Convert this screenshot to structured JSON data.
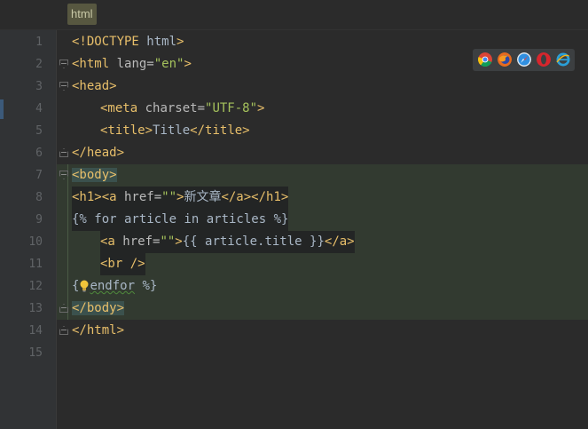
{
  "breadcrumb": {
    "label": "html"
  },
  "lines": [
    {
      "num": "1"
    },
    {
      "num": "2"
    },
    {
      "num": "3"
    },
    {
      "num": "4"
    },
    {
      "num": "5"
    },
    {
      "num": "6"
    },
    {
      "num": "7"
    },
    {
      "num": "8"
    },
    {
      "num": "9"
    },
    {
      "num": "10"
    },
    {
      "num": "11"
    },
    {
      "num": "12"
    },
    {
      "num": "13"
    },
    {
      "num": "14"
    },
    {
      "num": "15"
    }
  ],
  "code": {
    "l1": {
      "open": "<!DOCTYPE ",
      "name": "html",
      "close": ">"
    },
    "l2": {
      "tag": "<html",
      "attr": " lang=",
      "val": "\"en\"",
      "close": ">"
    },
    "l3": {
      "tag": "<head>"
    },
    "l4": {
      "tag": "<meta",
      "attr": " charset=",
      "val": "\"UTF-8\"",
      "close": ">"
    },
    "l5": {
      "open": "<title>",
      "text": "Title",
      "close": "</title>"
    },
    "l6": {
      "tag": "</head>"
    },
    "l7": {
      "tag": "<body>"
    },
    "l8": {
      "h1": "<h1>",
      "a": "<a",
      "attr": " href=",
      "val": "\"\"",
      "gt": ">",
      "text": "新文章",
      "aend": "</a>",
      "h1end": "</h1>"
    },
    "l9": {
      "text": "{% for article in articles %}"
    },
    "l10": {
      "a": "<a",
      "attr": " href=",
      "val": "\"\"",
      "gt": ">",
      "text": "{{ article.title }}",
      "aend": "</a>"
    },
    "l11": {
      "tag": "<br />"
    },
    "l12": {
      "pre": "{",
      "kw": "endfor",
      "post": " %}"
    },
    "l13": {
      "tag": "</body>"
    },
    "l14": {
      "tag": "</html>"
    }
  },
  "browsers": [
    {
      "icon": "chrome-icon",
      "color": "#e0b335"
    },
    {
      "icon": "firefox-icon",
      "color": "#e66b1f"
    },
    {
      "icon": "safari-icon",
      "color": "#2f8fe0"
    },
    {
      "icon": "opera-icon",
      "color": "#d7262d"
    },
    {
      "icon": "ie-icon",
      "color": "#2a9fd8"
    }
  ]
}
